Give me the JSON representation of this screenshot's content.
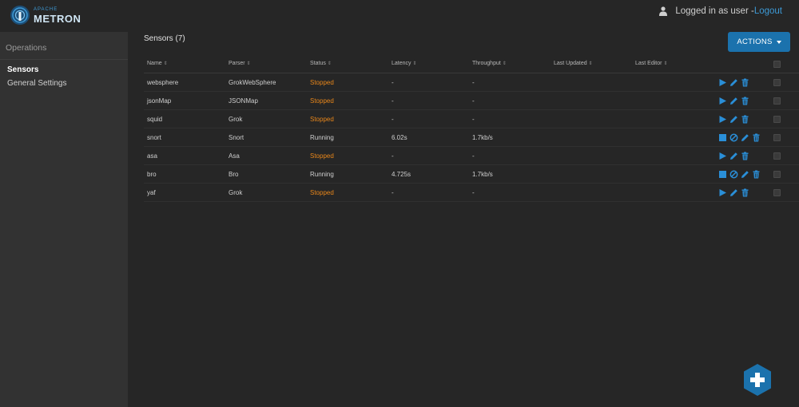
{
  "header": {
    "logo_small": "APACHE",
    "logo_big": "METRON",
    "user_text": "Logged in as user - ",
    "logout_label": "Logout",
    "accent_color": "#3d9ad6"
  },
  "sidebar": {
    "heading": "Operations",
    "items": [
      {
        "label": "Sensors",
        "active": true
      },
      {
        "label": "General Settings",
        "active": false
      }
    ]
  },
  "main": {
    "title": "Sensors (7)",
    "actions_label": "ACTIONS",
    "columns": [
      "Name",
      "Parser",
      "Status",
      "Latency",
      "Throughput",
      "Last Updated",
      "Last Editor"
    ],
    "rows": [
      {
        "name": "websphere",
        "parser": "GrokWebSphere",
        "status": "Stopped",
        "latency": "-",
        "throughput": "-",
        "last_updated": "",
        "last_editor": "",
        "running": false
      },
      {
        "name": "jsonMap",
        "parser": "JSONMap",
        "status": "Stopped",
        "latency": "-",
        "throughput": "-",
        "last_updated": "",
        "last_editor": "",
        "running": false
      },
      {
        "name": "squid",
        "parser": "Grok",
        "status": "Stopped",
        "latency": "-",
        "throughput": "-",
        "last_updated": "",
        "last_editor": "",
        "running": false
      },
      {
        "name": "snort",
        "parser": "Snort",
        "status": "Running",
        "latency": "6.02s",
        "throughput": "1.7kb/s",
        "last_updated": "",
        "last_editor": "",
        "running": true
      },
      {
        "name": "asa",
        "parser": "Asa",
        "status": "Stopped",
        "latency": "-",
        "throughput": "-",
        "last_updated": "",
        "last_editor": "",
        "running": false
      },
      {
        "name": "bro",
        "parser": "Bro",
        "status": "Running",
        "latency": "4.725s",
        "throughput": "1.7kb/s",
        "last_updated": "",
        "last_editor": "",
        "running": true
      },
      {
        "name": "yaf",
        "parser": "Grok",
        "status": "Stopped",
        "latency": "-",
        "throughput": "-",
        "last_updated": "",
        "last_editor": "",
        "running": false
      }
    ]
  },
  "colors": {
    "stopped": "#e8861a",
    "action_icon": "#2a8fd8",
    "button": "#1b72ad"
  },
  "icons": {
    "user": "user-icon",
    "start": "play-icon",
    "stop": "stop-icon",
    "disable": "disable-icon",
    "edit": "pencil-icon",
    "delete": "trash-icon",
    "add": "plus-icon"
  }
}
